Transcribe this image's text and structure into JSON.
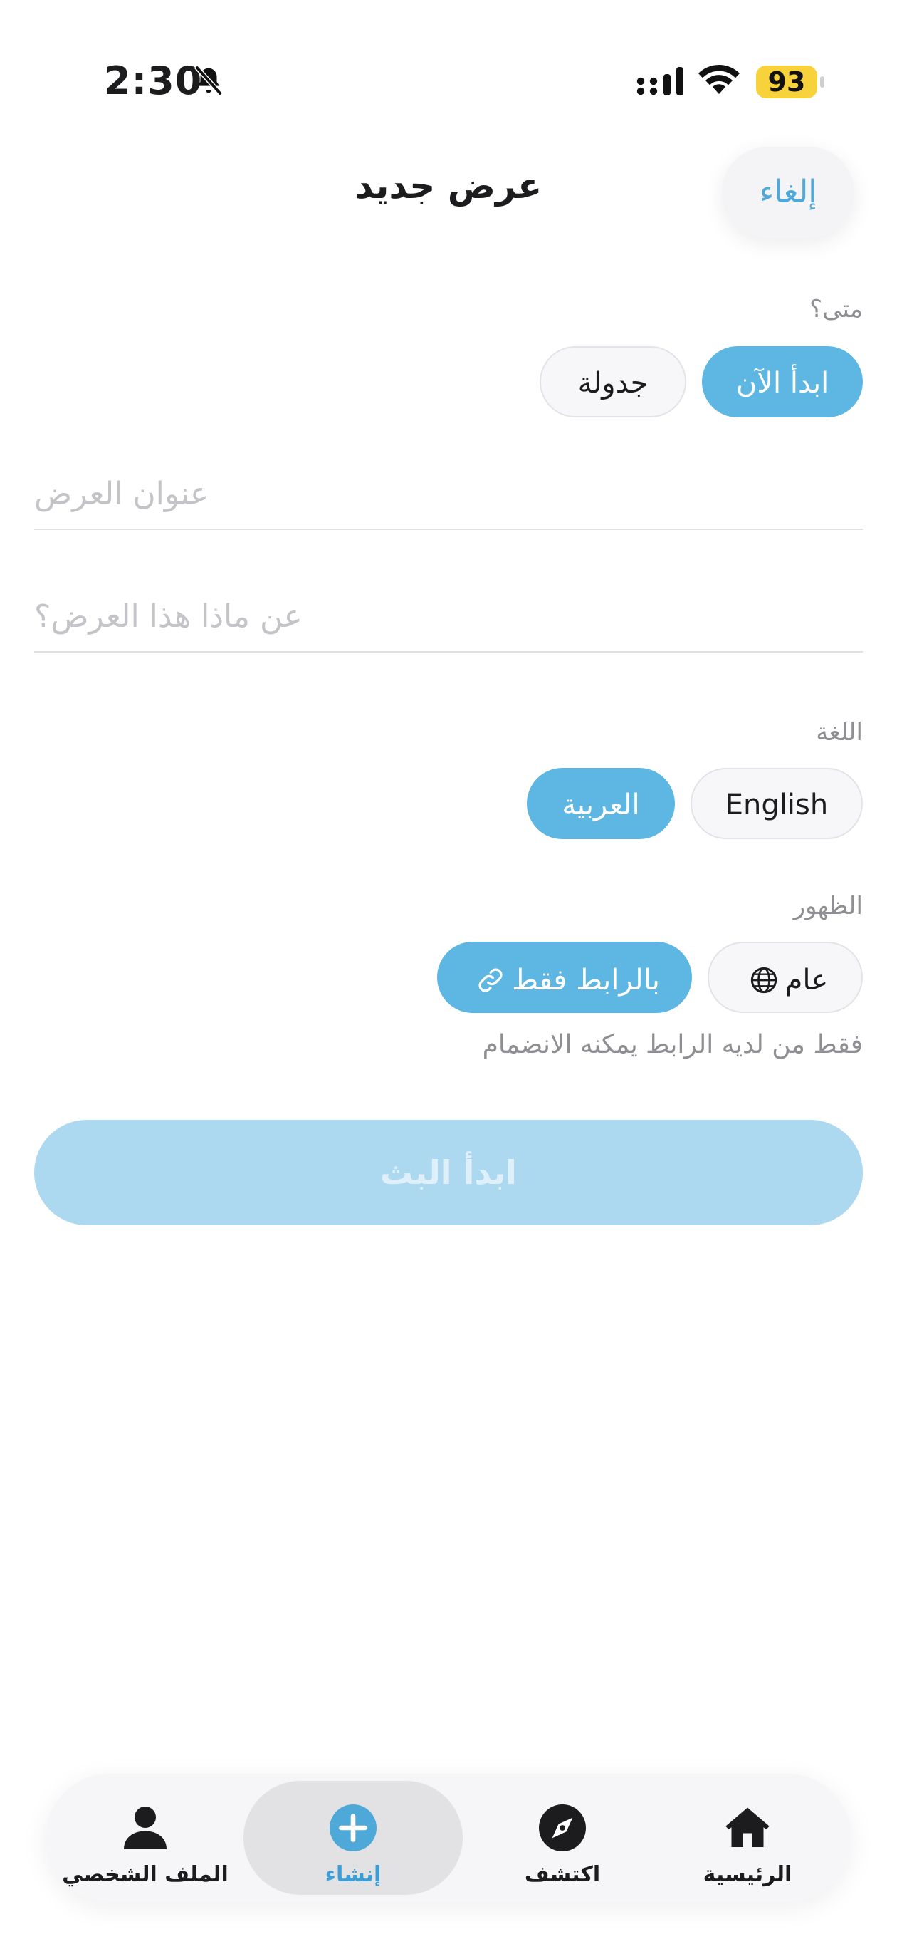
{
  "status_bar": {
    "time": "2:30",
    "battery": "93"
  },
  "header": {
    "title": "عرض جديد",
    "cancel_label": "إلغاء"
  },
  "when": {
    "label": "متى؟",
    "options": [
      "ابدأ الآن",
      "جدولة"
    ],
    "selected": "ابدأ الآن"
  },
  "form": {
    "title_placeholder": "عنوان العرض",
    "about_placeholder": "عن ماذا هذا العرض؟"
  },
  "language": {
    "label": "اللغة",
    "options": [
      "English",
      "العربية"
    ],
    "selected": "العربية"
  },
  "visibility": {
    "label": "الظهور",
    "options": [
      {
        "label": "عام",
        "icon": "globe-icon"
      },
      {
        "label": "بالرابط فقط",
        "icon": "link-icon"
      }
    ],
    "selected": "بالرابط فقط",
    "hint": "فقط من لديه الرابط يمكنه الانضمام"
  },
  "start_button_label": "ابدأ البث",
  "tabbar": {
    "items": [
      {
        "label": "الرئيسية",
        "icon": "home-icon"
      },
      {
        "label": "اكتشف",
        "icon": "compass-icon"
      },
      {
        "label": "إنشاء",
        "icon": "plus-circle-icon"
      },
      {
        "label": "الملف الشخصي",
        "icon": "person-icon"
      }
    ],
    "selected": "إنشاء"
  },
  "colors": {
    "accent": "#5eb6e2",
    "accent_disabled": "#acd8f0",
    "battery": "#f7d23a"
  }
}
